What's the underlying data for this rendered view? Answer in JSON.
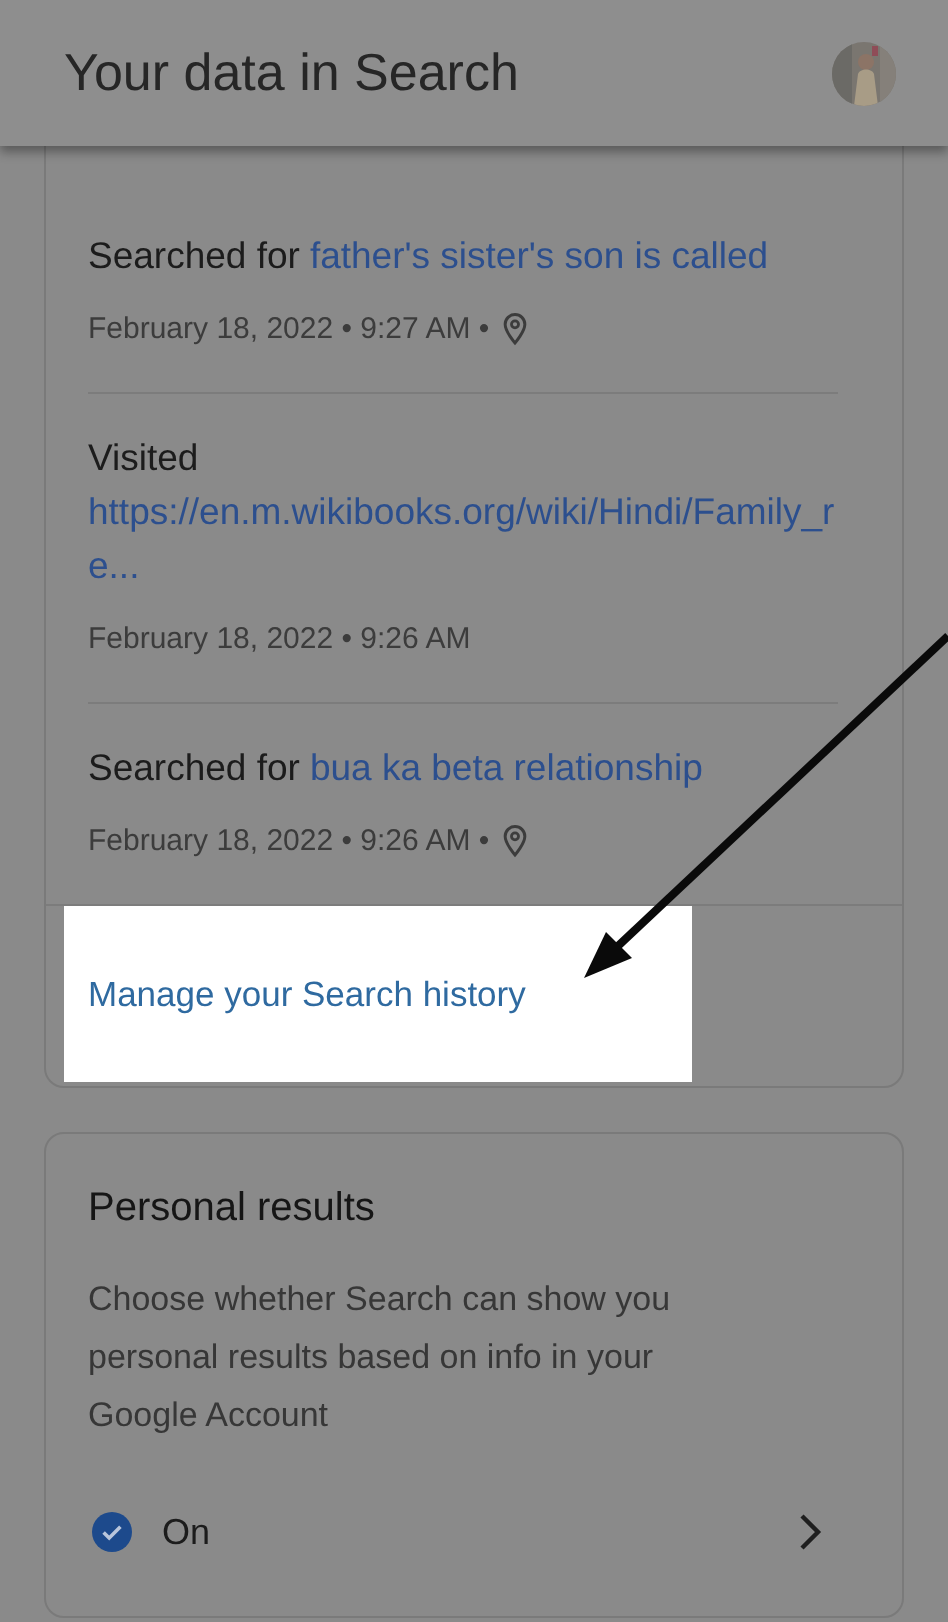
{
  "header": {
    "title": "Your data in Search"
  },
  "history_card": {
    "entries": [
      {
        "kind": "search",
        "action": "Searched for",
        "query": "father's sister's son is called",
        "date": "February 18, 2022 • 9:27 AM •",
        "location": true
      },
      {
        "kind": "visit",
        "action": "Visited",
        "query": "https://en.m.wikibooks.org/wiki/Hindi/Family_re...",
        "date": "February 18, 2022 • 9:26 AM",
        "location": false
      },
      {
        "kind": "search",
        "action": "Searched for",
        "query": "bua ka beta relationship",
        "date": "February 18, 2022 • 9:26 AM •",
        "location": true
      }
    ],
    "manage_link": "Manage your Search history"
  },
  "personal_results": {
    "title": "Personal results",
    "description": "Choose whether Search can show you personal results based on info in your Google Account",
    "status": {
      "label": "On",
      "checked": true
    }
  }
}
